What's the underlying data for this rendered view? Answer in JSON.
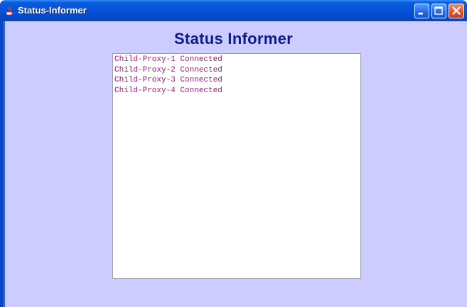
{
  "window": {
    "title": "Status-Informer",
    "icons": {
      "app": "java-coffee-cup-icon",
      "minimize": "minimize-icon",
      "maximize": "maximize-icon",
      "close": "close-icon"
    },
    "colors": {
      "titlebar": "#0653d8",
      "client_background": "#ccccfe",
      "heading": "#0d1c8c",
      "log_text": "#a0198a"
    }
  },
  "main": {
    "heading": "Status Informer",
    "log_lines": [
      "Child-Proxy-1 Connected",
      "Child-Proxy-2 Connected",
      "Child-Proxy-3 Connected",
      "Child-Proxy-4 Connected"
    ]
  }
}
